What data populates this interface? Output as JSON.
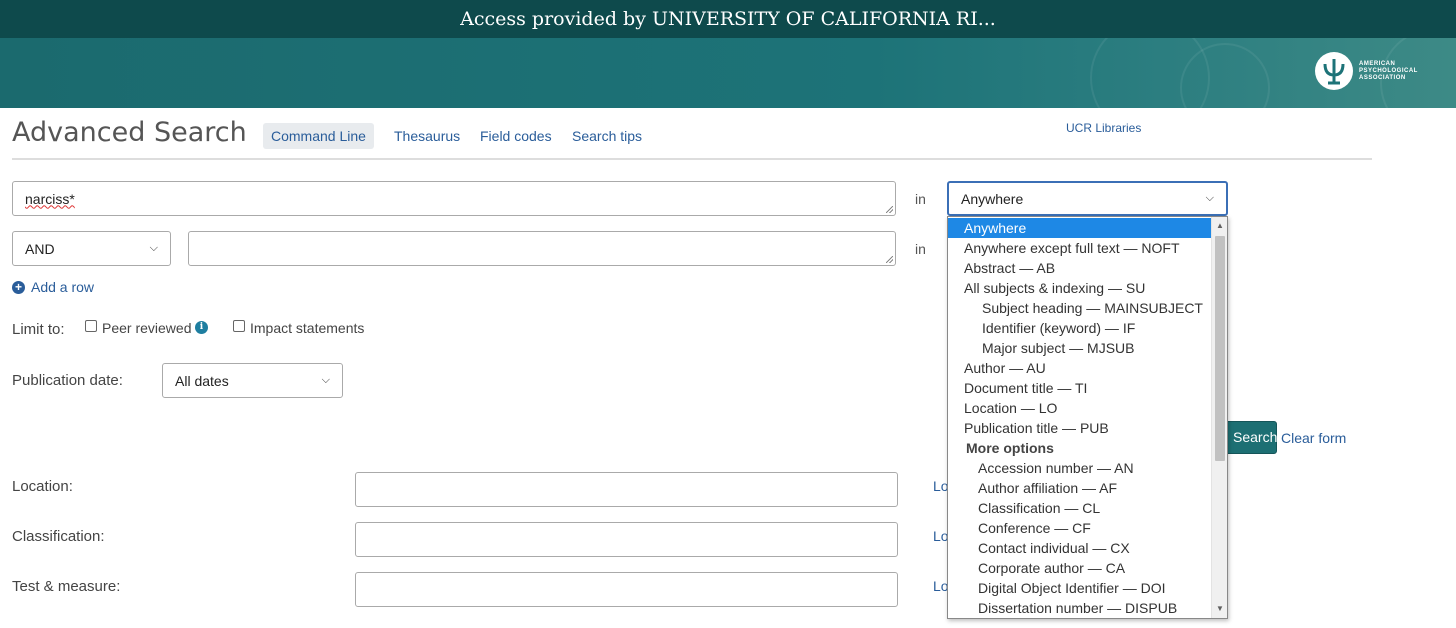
{
  "access_bar": {
    "text": "Access provided by UNIVERSITY OF CALIFORNIA RI..."
  },
  "banner": {
    "logo_lines": [
      "AMERICAN",
      "PSYCHOLOGICAL",
      "ASSOCIATION"
    ]
  },
  "header": {
    "title": "Advanced Search",
    "tabs": [
      {
        "label": "Command Line"
      },
      {
        "label": "Thesaurus"
      },
      {
        "label": "Field codes"
      },
      {
        "label": "Search tips"
      }
    ],
    "institution": "UCR Libraries"
  },
  "search": {
    "row1_value": "narciss*",
    "in_label": "in",
    "field_select_value": "Anywhere",
    "operator_value": "AND",
    "row2_value": "",
    "add_row": "Add a row"
  },
  "limit": {
    "label": "Limit to:",
    "peer_reviewed": "Peer reviewed",
    "impact_statements": "Impact statements"
  },
  "publication_date": {
    "label": "Publication date:",
    "value": "All dates"
  },
  "actions": {
    "search": "Search",
    "clear": "Clear form"
  },
  "fields": [
    {
      "label": "Location:",
      "value": "",
      "link": "Lo"
    },
    {
      "label": "Classification:",
      "value": "",
      "link": "Lo"
    },
    {
      "label": "Test & measure:",
      "value": "",
      "link": "Lo"
    }
  ],
  "dropdown": {
    "options": [
      {
        "label": "Anywhere"
      },
      {
        "label": "Anywhere except full text — NOFT"
      },
      {
        "label": "Abstract — AB"
      },
      {
        "label": "All subjects & indexing — SU"
      },
      {
        "label": "Subject heading — MAINSUBJECT"
      },
      {
        "label": "Identifier (keyword) — IF"
      },
      {
        "label": "Major subject — MJSUB"
      },
      {
        "label": "Author — AU"
      },
      {
        "label": "Document title — TI"
      },
      {
        "label": "Location — LO"
      },
      {
        "label": "Publication title — PUB"
      },
      {
        "label": "More options"
      },
      {
        "label": "Accession number — AN"
      },
      {
        "label": "Author affiliation — AF"
      },
      {
        "label": "Classification — CL"
      },
      {
        "label": "Conference — CF"
      },
      {
        "label": "Contact individual — CX"
      },
      {
        "label": "Corporate author — CA"
      },
      {
        "label": "Digital Object Identifier — DOI"
      },
      {
        "label": "Dissertation number — DISPUB"
      }
    ]
  },
  "colors": {
    "header_dark": "#0e4a4c",
    "banner": "#1d7378",
    "link": "#2a5d9a",
    "selected": "#1e88e5",
    "button": "#1d6f73"
  }
}
